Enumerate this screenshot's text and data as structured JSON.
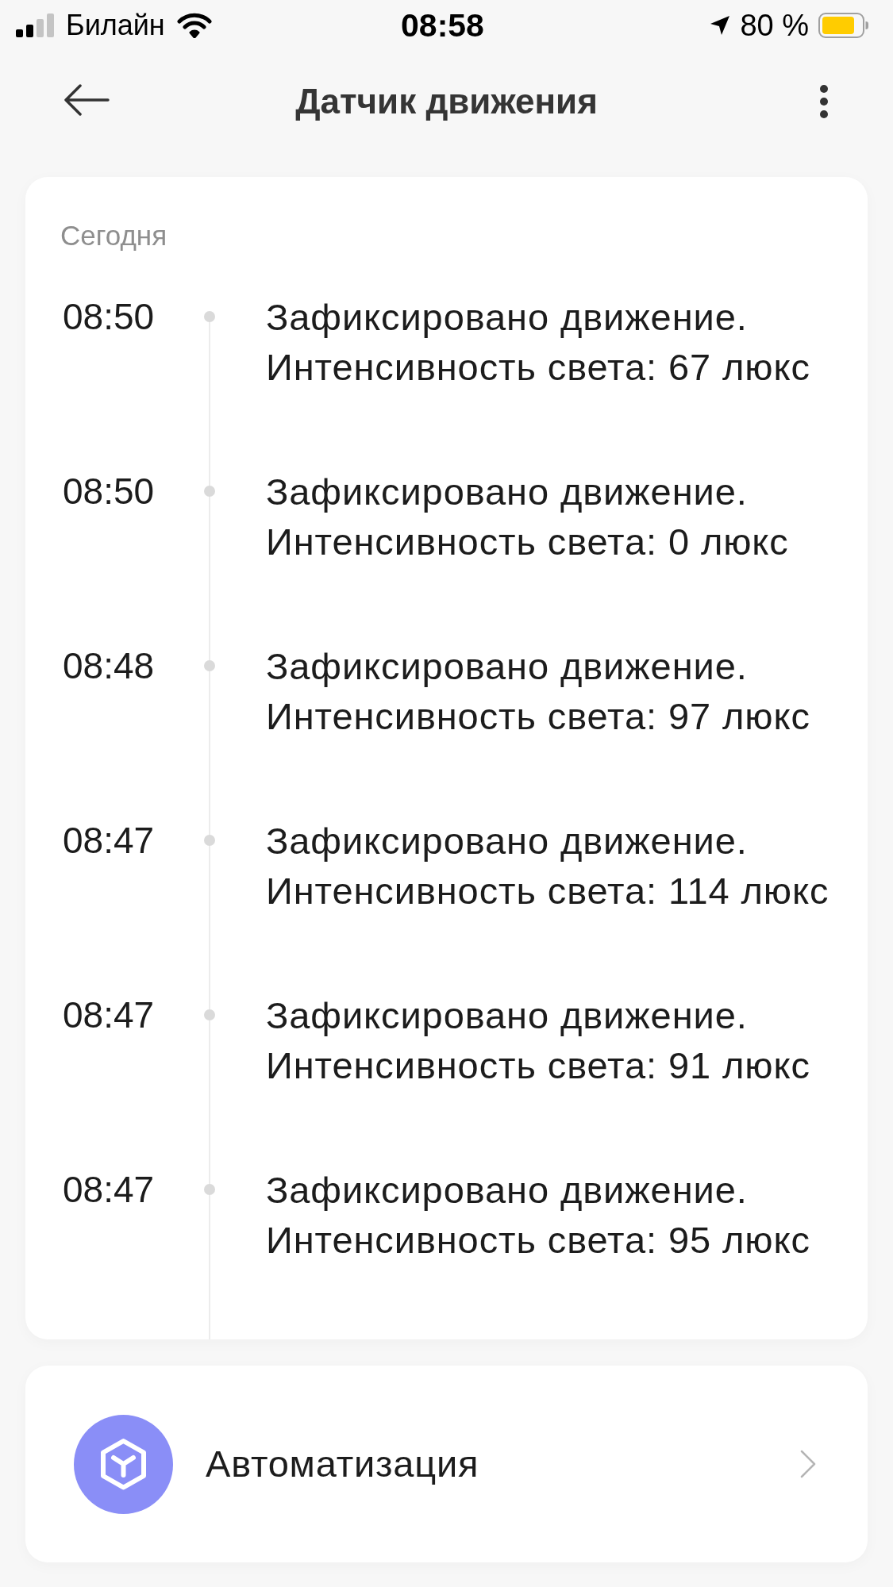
{
  "status_bar": {
    "carrier": "Билайн",
    "time": "08:58",
    "battery": "80 %"
  },
  "header": {
    "title": "Датчик движения"
  },
  "history": {
    "date": "Сегодня",
    "events": [
      {
        "time": "08:50",
        "text": "Зафиксировано движение. Интенсивность света: 67 люкс"
      },
      {
        "time": "08:50",
        "text": "Зафиксировано движение. Интенсивность света: 0 люкс"
      },
      {
        "time": "08:48",
        "text": "Зафиксировано движение. Интенсивность света: 97 люкс"
      },
      {
        "time": "08:47",
        "text": "Зафиксировано движение. Интенсивность света: 114 люкс"
      },
      {
        "time": "08:47",
        "text": "Зафиксировано движение. Интенсивность света: 91 люкс"
      },
      {
        "time": "08:47",
        "text": "Зафиксировано движение. Интенсивность света: 95 люкс"
      }
    ]
  },
  "automation": {
    "label": "Автоматизация"
  }
}
